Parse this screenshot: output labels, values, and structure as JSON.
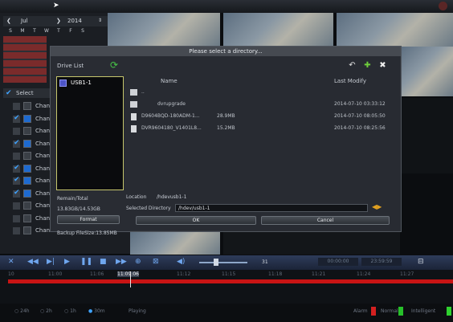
{
  "calendar": {
    "month": "Jul",
    "year": "2014",
    "weekdays": [
      "S",
      "M",
      "T",
      "W",
      "T",
      "F",
      "S"
    ]
  },
  "left_panel": {
    "select_label": "Select",
    "channels": [
      {
        "label": "Chan",
        "checked": false,
        "active": false
      },
      {
        "label": "Chan",
        "checked": true,
        "active": true
      },
      {
        "label": "Chan",
        "checked": false,
        "active": false
      },
      {
        "label": "Chan",
        "checked": true,
        "active": true
      },
      {
        "label": "Chan",
        "checked": false,
        "active": false
      },
      {
        "label": "Chan",
        "checked": true,
        "active": true
      },
      {
        "label": "Chan",
        "checked": true,
        "active": true
      },
      {
        "label": "Chan",
        "checked": true,
        "active": true
      },
      {
        "label": "Chan",
        "checked": false,
        "active": false
      },
      {
        "label": "Chan",
        "checked": false,
        "active": false
      },
      {
        "label": "Chan",
        "checked": false,
        "active": false
      }
    ]
  },
  "dialog": {
    "title": "Please select a directory...",
    "drive_list_label": "Drive List",
    "drive": "USB1-1",
    "col_name": "Name",
    "col_modify": "Last Modify",
    "files": [
      {
        "name": "..",
        "size": "",
        "date": "",
        "type": "folder"
      },
      {
        "name": "dvrupgrade",
        "size": "",
        "date": "2014-07-10 03:33:12",
        "type": "folder"
      },
      {
        "name": "D9604BQD-180ADM-1...",
        "size": "28.9MB",
        "date": "2014-07-10 08:05:50",
        "type": "file"
      },
      {
        "name": "DVR9604180_V1401L8...",
        "size": "15.2MB",
        "date": "2014-07-10 08:25:56",
        "type": "file"
      }
    ],
    "remain_label": "Remain/Total",
    "remain_value": "13.83GB/14.53GB",
    "format_button": "Format",
    "backup_size": "Backup FileSize:13.85MB",
    "location_label": "Location",
    "location_value": "/hdevusb1-1",
    "selected_dir_label": "Selected Directory",
    "selected_dir_value": "/hdev/usb1-1",
    "ok_button": "OK",
    "cancel_button": "Cancel"
  },
  "controls": {
    "volume_value": "31",
    "time_start": "00:00:00",
    "time_end": "23:59:59"
  },
  "timeline": {
    "hours": [
      "10",
      "11:00",
      "11:06",
      "11:09:06",
      "11:12",
      "11:15",
      "11:18",
      "11:21",
      "11:24",
      "11:27"
    ],
    "current": "11:09:06"
  },
  "status": {
    "options": [
      "24h",
      "2h",
      "1h",
      "30m"
    ],
    "selected": "30m",
    "playing": "Playing",
    "legend": [
      {
        "label": "Alarm",
        "color": "#d42020"
      },
      {
        "label": "Normal",
        "color": "#27c02a"
      },
      {
        "label": "Intelligent",
        "color": "#2fd12f"
      }
    ]
  }
}
